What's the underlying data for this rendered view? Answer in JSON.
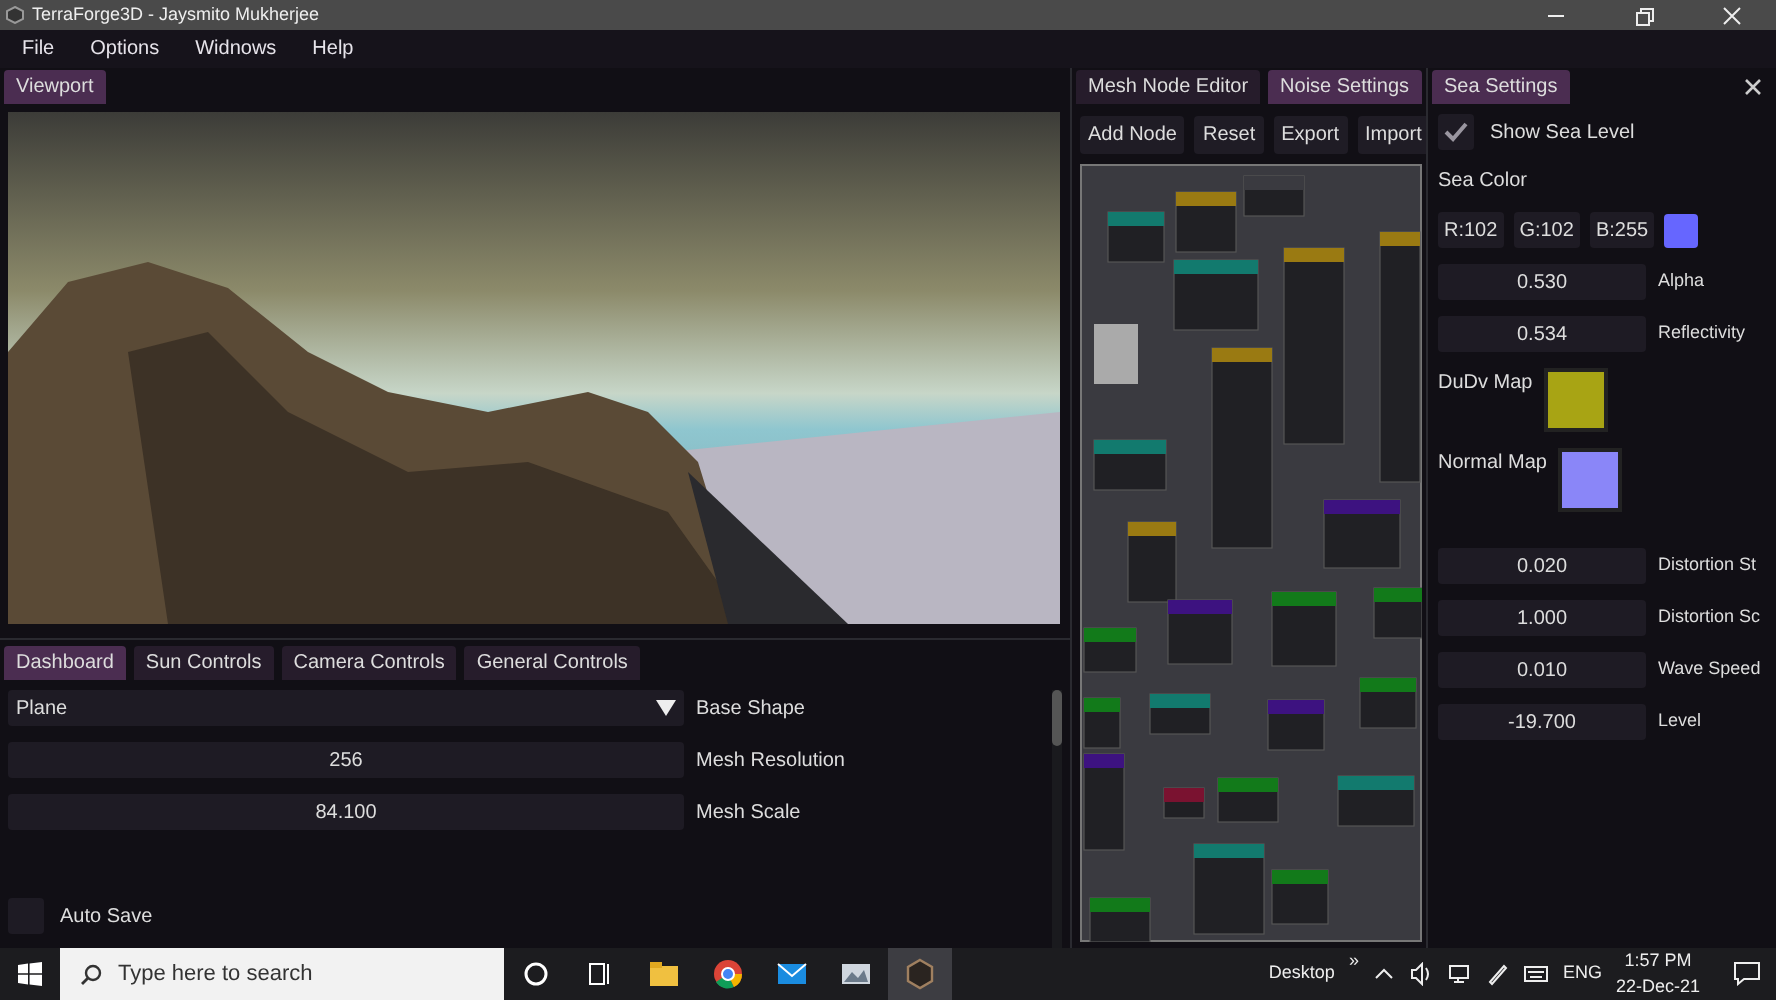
{
  "window": {
    "title": "TerraForge3D - Jaysmito Mukherjee"
  },
  "menu": [
    "File",
    "Options",
    "Widnows",
    "Help"
  ],
  "viewport": {
    "tabs": [
      {
        "label": "Viewport",
        "selected": true
      }
    ]
  },
  "dashboard": {
    "tabs": [
      {
        "label": "Dashboard",
        "selected": true
      },
      {
        "label": "Sun Controls",
        "selected": false
      },
      {
        "label": "Camera Controls",
        "selected": false
      },
      {
        "label": "General Controls",
        "selected": false
      }
    ],
    "base_shape": {
      "value": "Plane",
      "label": "Base Shape"
    },
    "fields": [
      {
        "value": "256",
        "label": "Mesh Resolution"
      },
      {
        "value": "84.100",
        "label": "Mesh Scale"
      }
    ],
    "checkboxes": [
      {
        "label": "Auto Save",
        "checked": false
      }
    ]
  },
  "node_panel": {
    "tabs": [
      {
        "label": "Mesh Node Editor",
        "selected": false
      },
      {
        "label": "Noise Settings",
        "selected": true
      }
    ],
    "buttons": [
      "Add Node",
      "Reset",
      "Export",
      "Import"
    ]
  },
  "sea_panel": {
    "tabs": [
      {
        "label": "Sea Settings",
        "selected": true
      }
    ],
    "show_sea_level": {
      "label": "Show Sea Level",
      "checked": true
    },
    "sea_color": {
      "label": "Sea Color",
      "channels": [
        "R:102",
        "G:102",
        "B:255"
      ],
      "color": "#6666ff"
    },
    "fields_top": [
      {
        "value": "0.530",
        "label": "Alpha"
      },
      {
        "value": "0.534",
        "label": "Reflectivity"
      }
    ],
    "textures": [
      {
        "label": "DuDv Map",
        "color": "#a8a414"
      },
      {
        "label": "Normal Map",
        "color": "#8a86f8"
      }
    ],
    "fields": [
      {
        "value": "0.020",
        "label": "Distortion St"
      },
      {
        "value": "1.000",
        "label": "Distortion Sc"
      },
      {
        "value": "0.010",
        "label": "Wave Speed"
      },
      {
        "value": "-19.700",
        "label": "Level"
      }
    ]
  },
  "taskbar": {
    "search_placeholder": "Type here to search",
    "apps": [
      {
        "kind": "cortana",
        "active": false
      },
      {
        "kind": "taskview",
        "active": false
      },
      {
        "kind": "folder",
        "active": false
      },
      {
        "kind": "chrome",
        "active": false
      },
      {
        "kind": "mail",
        "active": false
      },
      {
        "kind": "photos",
        "active": false
      },
      {
        "kind": "terraforge",
        "active": true
      }
    ],
    "desktop": "Desktop",
    "overflow": "»",
    "language": "ENG",
    "time": "1:57 PM",
    "date": "22-Dec-21"
  }
}
